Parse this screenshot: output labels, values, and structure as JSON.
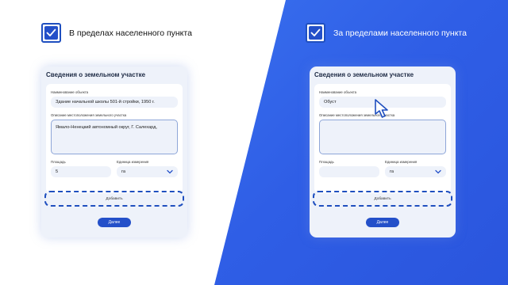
{
  "left_option": {
    "label": "В пределах населенного пункта",
    "checked": true
  },
  "right_option": {
    "label": "За пределами населенного пункта",
    "checked": true
  },
  "left_form": {
    "title": "Сведения о земельном участке",
    "name_label": "Наименование объекта",
    "name_value": "Здание начальной школы 501-й стройки, 1950 г.",
    "location_label": "Описание местоположения земельного участка",
    "location_value": "Ямало-Ненецкий автономный округ, Г. Салехард,",
    "area_label": "Площадь",
    "area_value": "5",
    "unit_label": "Единица измерения",
    "unit_value": "га",
    "add_label": "Добавить",
    "next_label": "Далее"
  },
  "right_form": {
    "title": "Сведения о земельном участке",
    "name_label": "Наименование объекта",
    "name_value": "Обуст",
    "location_label": "Описание местоположения земельного участка",
    "location_value": "",
    "area_label": "Площадь",
    "area_value": "",
    "unit_label": "Единица измерения",
    "unit_value": "га",
    "add_label": "Добавить",
    "next_label": "Далее"
  },
  "colors": {
    "accent": "#2450c9",
    "background_blue": "#3569ee",
    "card": "#eef2fa"
  },
  "icons": {
    "checkbox": "check-icon",
    "select": "chevron-down-icon",
    "pointer": "cursor-arrow-icon"
  }
}
